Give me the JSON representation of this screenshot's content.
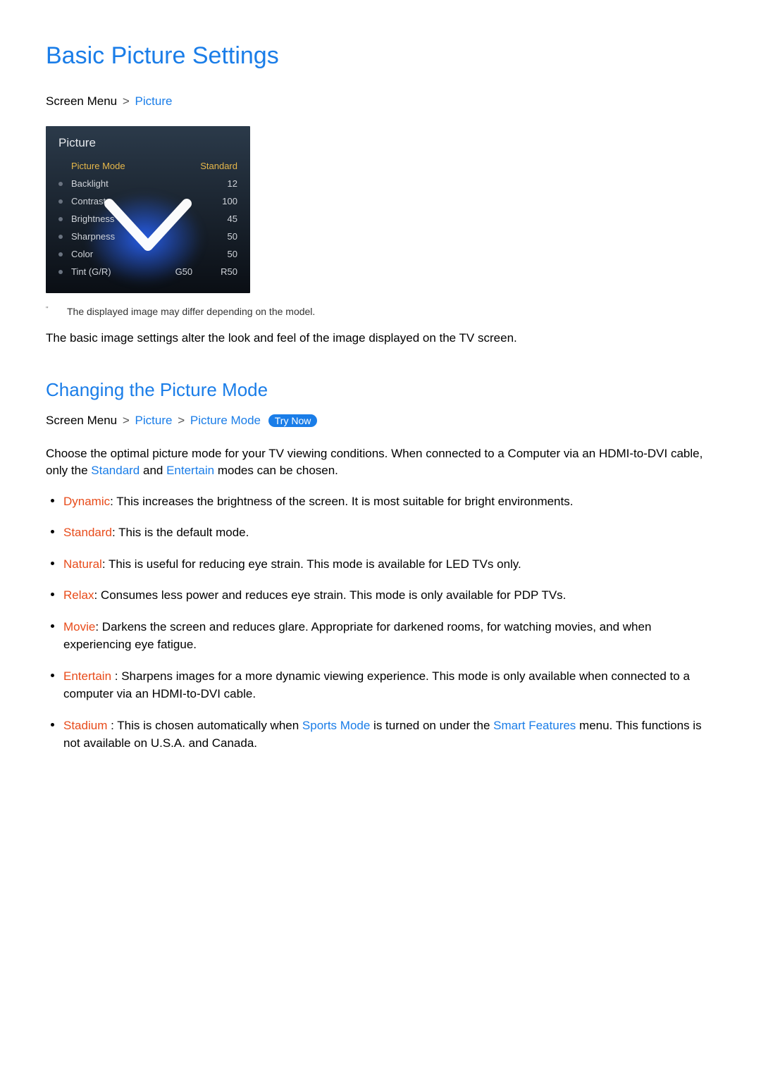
{
  "page_title": "Basic Picture Settings",
  "breadcrumb1": {
    "prefix": "Screen Menu",
    "sep": ">",
    "item1": "Picture"
  },
  "tv_menu": {
    "title": "Picture",
    "header": {
      "label": "Picture Mode",
      "value": "Standard"
    },
    "rows": [
      {
        "label": "Backlight",
        "value": "12"
      },
      {
        "label": "Contrast",
        "value": "100"
      },
      {
        "label": "Brightness",
        "value": "45"
      },
      {
        "label": "Sharpness",
        "value": "50"
      },
      {
        "label": "Color",
        "value": "50"
      },
      {
        "label": "Tint (G/R)",
        "mid": "G50",
        "value": "R50"
      }
    ]
  },
  "footnote_mark": "\"",
  "footnote": "The displayed image may differ depending on the model.",
  "intro_para": "The basic image settings alter the look and feel of the image displayed on the TV screen.",
  "section2_title": "Changing the    Picture Mode",
  "breadcrumb2": {
    "prefix": "Screen Menu",
    "sep": ">",
    "item1": "Picture",
    "item2": "Picture Mode"
  },
  "try_now": "Try Now",
  "para2_parts": {
    "p1": "Choose the optimal picture mode for your TV viewing conditions. When connected to a Computer via an HDMI-to-DVI cable, only the ",
    "t1": "Standard",
    "p2": " and ",
    "t2": "Entertain",
    "p3": "    modes can be chosen."
  },
  "modes": [
    {
      "name": "Dynamic",
      "desc": ": This increases the brightness of the screen. It is most suitable for bright environments."
    },
    {
      "name": "Standard",
      "desc": ": This is the default mode."
    },
    {
      "name": "Natural",
      "desc": ": This is useful for reducing eye strain. This mode is available for LED TVs only."
    },
    {
      "name": "Relax",
      "desc": ": Consumes less power and reduces eye strain. This mode is only available for PDP TVs."
    },
    {
      "name": "Movie",
      "desc": ": Darkens the screen and reduces glare. Appropriate for darkened rooms, for watching movies, and when experiencing eye fatigue."
    },
    {
      "name": "Entertain",
      "desc": " : Sharpens images for a more dynamic viewing experience. This mode is only available when connected to a computer via an HDMI-to-DVI cable."
    }
  ],
  "stadium_mode": {
    "name": "Stadium",
    "p1": " : This is chosen automatically when ",
    "t1": "Sports Mode",
    "p2": "   is turned on under the ",
    "t2": "Smart Features",
    "p3": " menu. This functions is not available on U.S.A. and Canada."
  }
}
